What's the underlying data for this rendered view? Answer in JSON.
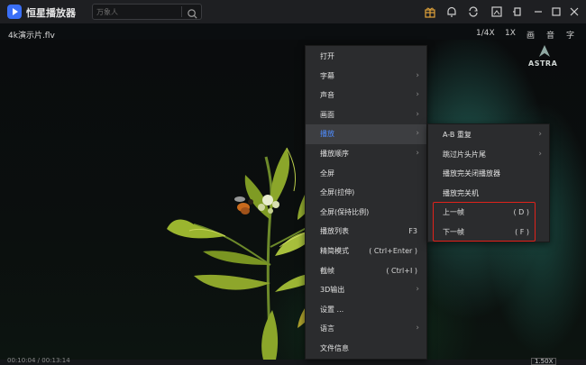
{
  "app": {
    "title": "恒星播放器",
    "file_name": "4k演示片.flv"
  },
  "search": {
    "placeholder": "万象人"
  },
  "toolbar": {
    "icons": [
      "gift-icon",
      "bell-icon",
      "loop-icon",
      "screenshot-icon",
      "pin-icon",
      "minimize-icon",
      "maximize-icon",
      "close-icon"
    ]
  },
  "view_controls": {
    "speed": "1/4X",
    "scale": "1X",
    "picture": "画",
    "audio": "音",
    "subtitle": "字"
  },
  "watermark": {
    "text": "ASTRA"
  },
  "status": {
    "timecode": "00:10:04 / 00:13:14",
    "zoom": "1.50X"
  },
  "context_menu": {
    "items": [
      {
        "label": "打开",
        "shortcut": "",
        "has_submenu": false
      },
      {
        "label": "字幕",
        "shortcut": "",
        "has_submenu": true
      },
      {
        "label": "声音",
        "shortcut": "",
        "has_submenu": true
      },
      {
        "label": "画面",
        "shortcut": "",
        "has_submenu": true
      },
      {
        "label": "播放",
        "shortcut": "",
        "has_submenu": true,
        "active": true
      },
      {
        "label": "播放顺序",
        "shortcut": "",
        "has_submenu": true
      },
      {
        "label": "全屏",
        "shortcut": "",
        "has_submenu": false
      },
      {
        "label": "全屏(拉伸)",
        "shortcut": "",
        "has_submenu": false
      },
      {
        "label": "全屏(保持比例)",
        "shortcut": "",
        "has_submenu": false
      },
      {
        "label": "播放列表",
        "shortcut": "F3",
        "has_submenu": false
      },
      {
        "label": "精简模式",
        "shortcut": "( Ctrl+Enter )",
        "has_submenu": false
      },
      {
        "label": "截帧",
        "shortcut": "( Ctrl+I )",
        "has_submenu": false
      },
      {
        "label": "3D输出",
        "shortcut": "",
        "has_submenu": true
      },
      {
        "label": "设置 ...",
        "shortcut": "",
        "has_submenu": false
      },
      {
        "label": "语言",
        "shortcut": "",
        "has_submenu": true
      },
      {
        "label": "文件信息",
        "shortcut": "",
        "has_submenu": false
      }
    ]
  },
  "play_submenu": {
    "items": [
      {
        "label": "A-B 重复",
        "shortcut": "",
        "has_submenu": true
      },
      {
        "label": "跳过片头片尾",
        "shortcut": "",
        "has_submenu": true
      },
      {
        "label": "播放完关闭播放器",
        "shortcut": "",
        "has_submenu": false
      },
      {
        "label": "播放完关机",
        "shortcut": "",
        "has_submenu": false
      },
      {
        "label": "上一帧",
        "shortcut": "( D )",
        "has_submenu": false
      },
      {
        "label": "下一帧",
        "shortcut": "( F )",
        "has_submenu": false
      }
    ]
  },
  "colors": {
    "accent": "#4f8dff",
    "highlight_box": "#e0221b",
    "menu_bg": "#2b2c2e",
    "titlebar_bg": "#1e1f22"
  }
}
